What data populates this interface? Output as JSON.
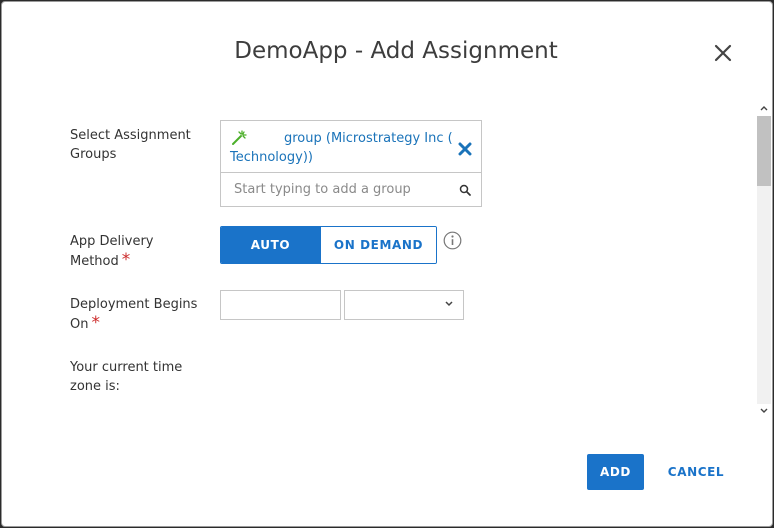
{
  "dialog": {
    "title": "DemoApp - Add Assignment",
    "close_icon": "close-icon"
  },
  "form": {
    "assignment_groups": {
      "label": "Select Assignment Groups",
      "selected_group": "group (Microstrategy Inc ( Technology))",
      "group_icon": "magic-wand-icon",
      "remove_icon": "remove-x-icon",
      "search_placeholder": "Start typing to add a group",
      "search_icon": "search-icon"
    },
    "app_delivery": {
      "label": "App Delivery Method",
      "required_marker": "*",
      "options": [
        "AUTO",
        "ON DEMAND"
      ],
      "selected": "AUTO",
      "info_icon": "info-icon"
    },
    "deployment": {
      "label": "Deployment Begins On",
      "required_marker": "*",
      "date_value": "",
      "time_value": "",
      "dropdown_icon": "chevron-down-icon"
    },
    "timezone": {
      "label": "Your current time zone is:"
    }
  },
  "footer": {
    "add_label": "ADD",
    "cancel_label": "CANCEL"
  },
  "colors": {
    "accent": "#1a73c9",
    "required": "#cc2a2a",
    "wand_green": "#4caf2a"
  }
}
